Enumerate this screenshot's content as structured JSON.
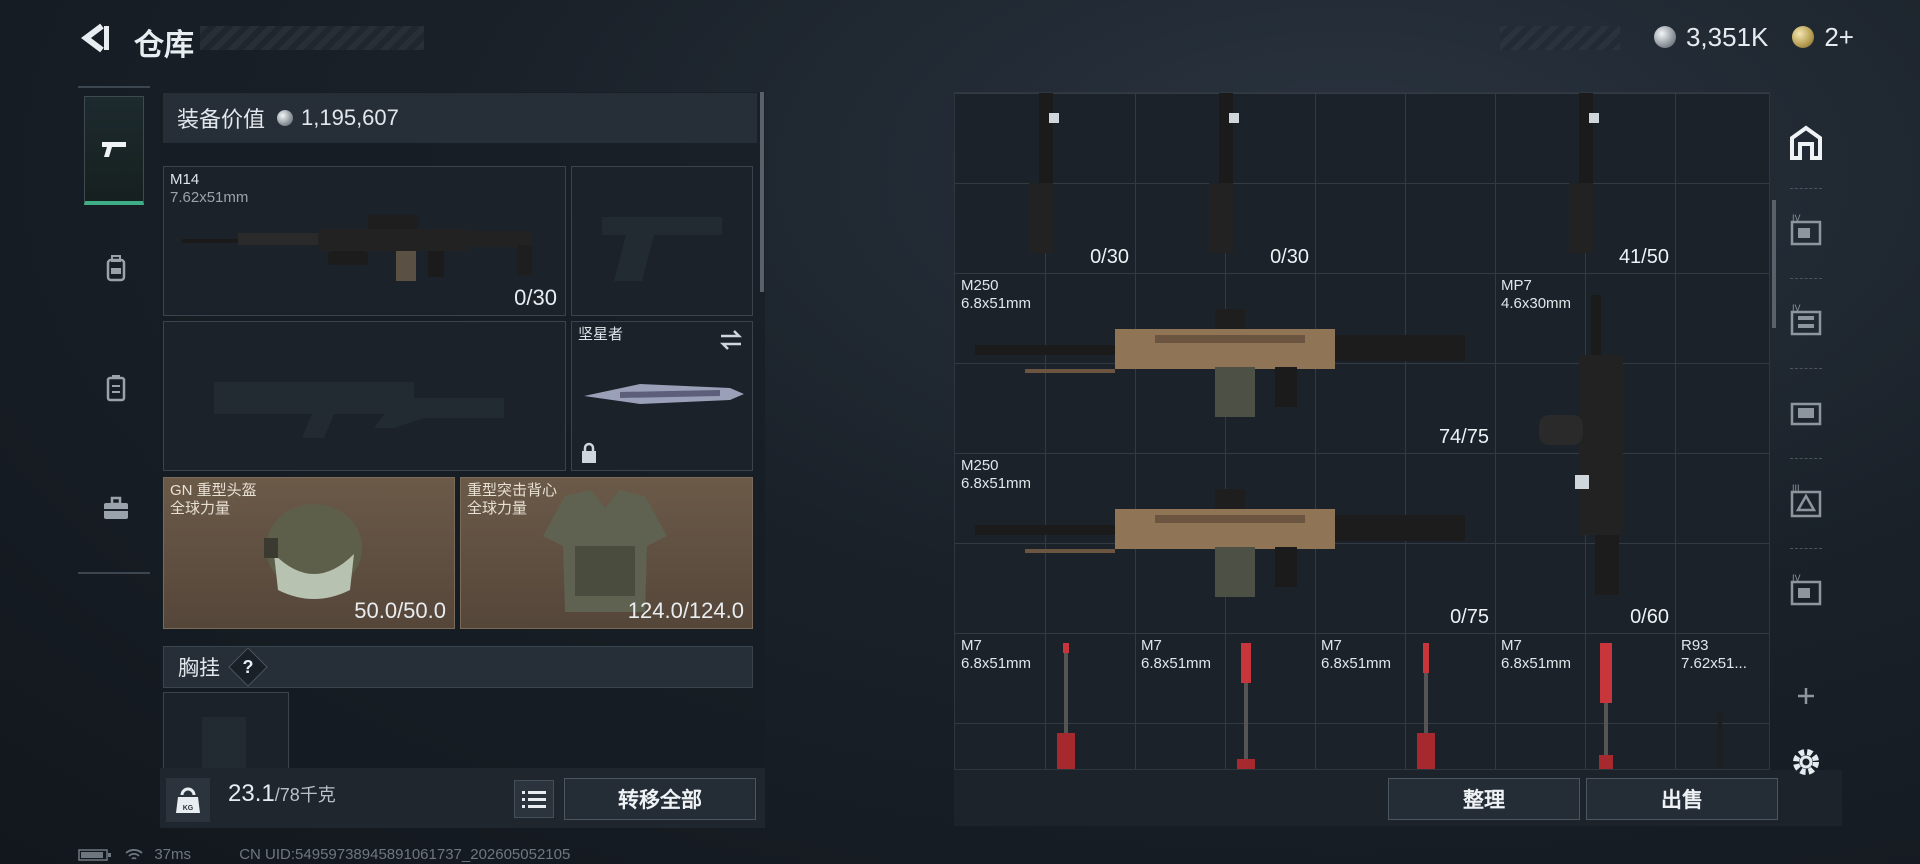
{
  "header": {
    "title": "仓库",
    "currency_silver": "3,351K",
    "currency_gold": "2+"
  },
  "loadout": {
    "value_label": "装备价值",
    "value": "1,195,607",
    "primary": {
      "name": "M14",
      "caliber": "7.62x51mm",
      "ammo": "0/30"
    },
    "melee": {
      "name": "坚星者"
    },
    "helmet": {
      "name": "GN 重型头盔",
      "sub": "全球力量",
      "durability": "50.0/50.0"
    },
    "vest": {
      "name": "重型突击背心",
      "sub": "全球力量",
      "durability": "124.0/124.0"
    },
    "section_title": "胸挂",
    "section_help": "?",
    "weight_value": "23.1",
    "weight_max": "/78千克",
    "weight_icon": "KG",
    "transfer_all": "转移全部"
  },
  "storage": {
    "top_row": [
      {
        "count": "0/30"
      },
      {
        "count": "0/30"
      },
      {
        "count": "41/50"
      }
    ],
    "items": [
      {
        "name": "M250",
        "caliber": "6.8x51mm",
        "count": "74/75"
      },
      {
        "name": "MP7",
        "caliber": "4.6x30mm",
        "count": "0/60"
      },
      {
        "name": "M250",
        "caliber": "6.8x51mm",
        "count": "0/75"
      }
    ],
    "ammo_row": [
      {
        "name": "M7",
        "caliber": "6.8x51mm"
      },
      {
        "name": "M7",
        "caliber": "6.8x51mm"
      },
      {
        "name": "M7",
        "caliber": "6.8x51mm"
      },
      {
        "name": "M7",
        "caliber": "6.8x51mm"
      },
      {
        "name": "R93",
        "caliber": "7.62x51..."
      }
    ],
    "sort_button": "整理",
    "sell_button": "出售"
  },
  "right_icons": [
    "storage-icon",
    "case-iv-icon",
    "case-iv-2-icon",
    "case-icon",
    "case-iii-icon",
    "case-iv-3-icon",
    "add-icon",
    "settings-icon"
  ],
  "status_bar": {
    "ping": "37ms",
    "uid": "CN UID:54959738945891061737_202605052105"
  },
  "colors": {
    "accent": "#3fae86",
    "armor_bg": "#6b5a48",
    "ammo_red": "#c8353a"
  }
}
